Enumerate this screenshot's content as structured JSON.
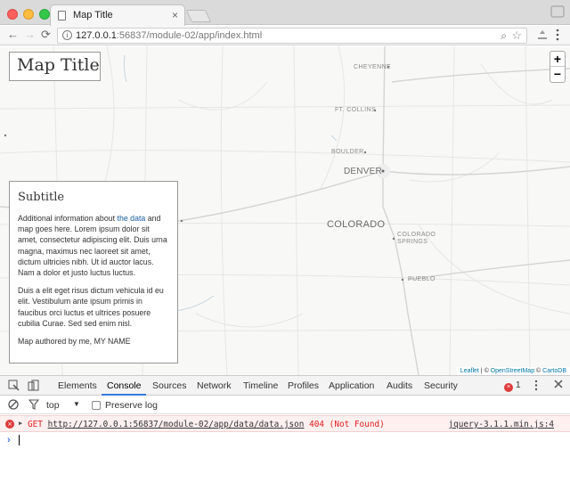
{
  "browser": {
    "tab_title": "Map Title",
    "tab_close": "×",
    "url_host": "127.0.0.1",
    "url_rest": ":56837/module-02/app/index.html",
    "info_glyph": "i",
    "zoom_glyph": "⌕",
    "star_glyph": "☆",
    "nav": {
      "back": "←",
      "forward": "→",
      "reload": "⟳"
    }
  },
  "map": {
    "title": "Map Title",
    "zoom_in": "+",
    "zoom_out": "−",
    "labels": {
      "cheyenne": "CHEYENNE",
      "fort_collins": "FT. COLLINS",
      "boulder": "BOULDER",
      "denver": "DENVER",
      "colorado": "COLORADO",
      "colorado_springs_1": "COLORADO",
      "colorado_springs_2": "SPRINGS",
      "pueblo": "PUEBLO"
    },
    "panel": {
      "heading": "Subtitle",
      "p1_before": "Additional information about ",
      "p1_link": "the data",
      "p1_after": " and map goes here. Lorem ipsum dolor sit amet, consectetur adipiscing elit. Duis urna magna, maximus nec laoreet sit amet, dictum ultricies nibh. Ut id auctor lacus. Nam a dolor et justo luctus luctus.",
      "p2": "Duis a elit eget risus dictum vehicula id eu elit. Vestibulum ante ipsum primis in faucibus orci luctus et ultrices posuere cubilia Curae. Sed sed enim nisl.",
      "p3": "Map authored by me, MY NAME"
    },
    "attribution": {
      "leaflet": "Leaflet",
      "sep1": " | © ",
      "osm": "OpenStreetMap",
      "sep2": " © ",
      "carto": "CartoDB"
    }
  },
  "devtools": {
    "tabs": [
      "Elements",
      "Console",
      "Sources",
      "Network",
      "Timeline",
      "Profiles",
      "Application",
      "Audits",
      "Security"
    ],
    "active_tab": "Console",
    "error_count": "1",
    "context": "top",
    "preserve_log": "Preserve log",
    "error": {
      "method": "GET",
      "url": "http://127.0.0.1:56837/module-02/app/data/data.json",
      "status": "404 (Not Found)",
      "source": "jquery-3.1.1.min.js:4"
    },
    "prompt": "›"
  }
}
